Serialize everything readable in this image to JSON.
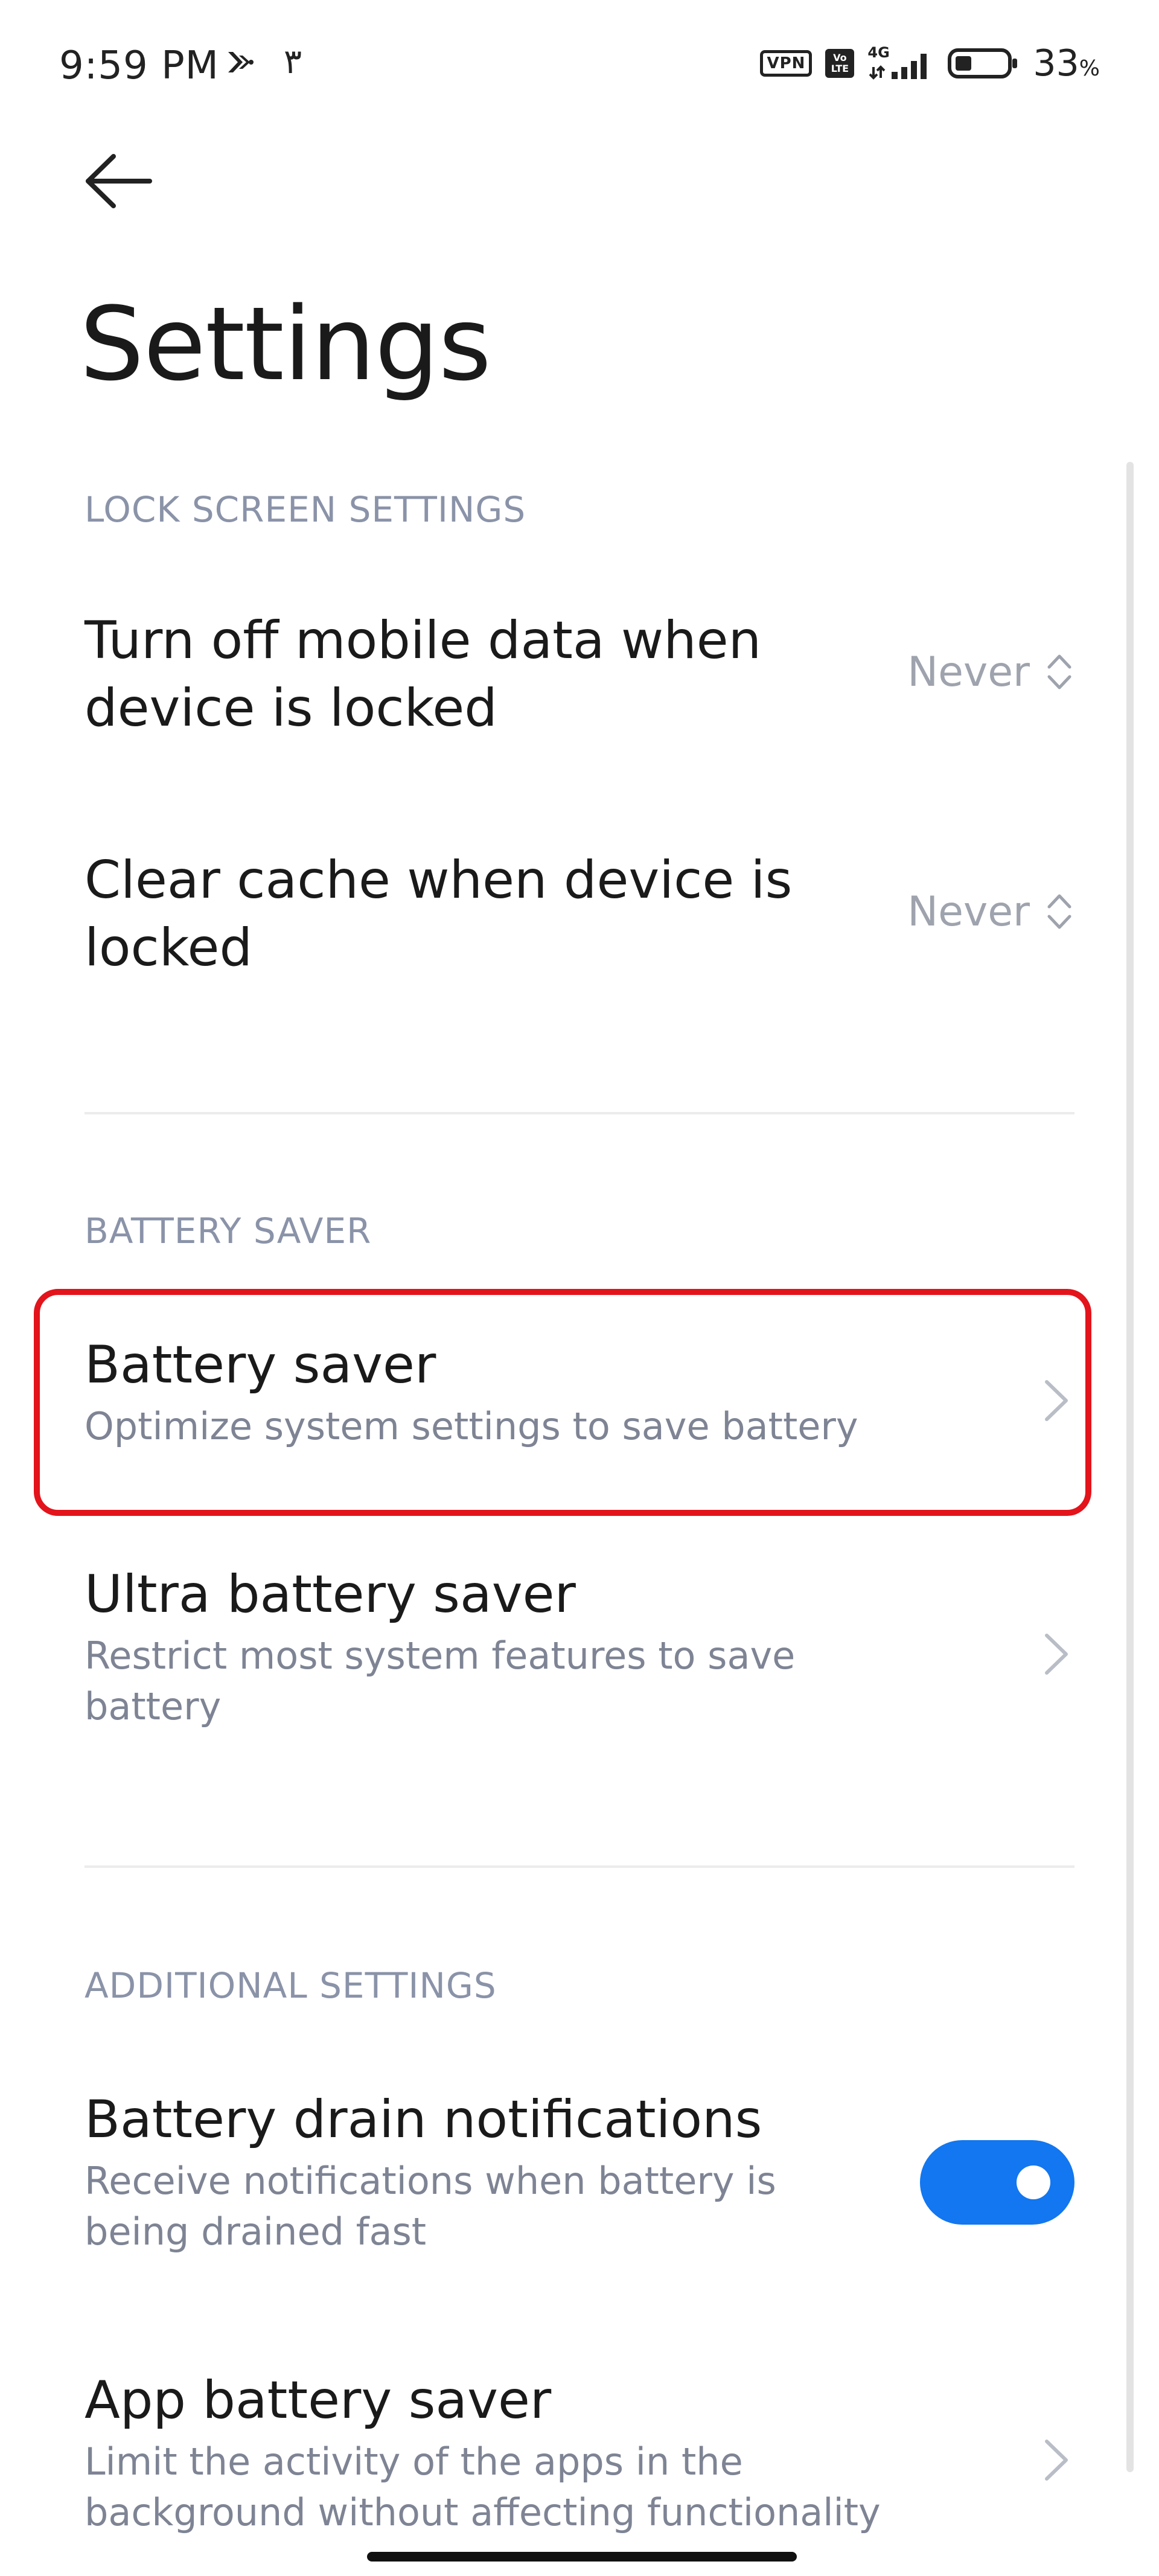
{
  "status_bar": {
    "time": "9:59 PM",
    "extra_digit": "٣",
    "vpn_label": "VPN",
    "volte_top": "Vo",
    "volte_bottom": "LTE",
    "network_label": "4G",
    "battery_percent": "33",
    "battery_unit": "%",
    "battery_level": 0.33,
    "left_icon": "app-notification-icon"
  },
  "header": {
    "back_icon": "back-arrow-icon",
    "title": "Settings"
  },
  "sections": {
    "lock_screen": {
      "header": "LOCK SCREEN SETTINGS",
      "items": [
        {
          "title_line1": "Turn off mobile data when",
          "title_line2": "device is locked",
          "value": "Never"
        },
        {
          "title_line1": "Clear cache when device is",
          "title_line2": "locked",
          "value": "Never"
        }
      ]
    },
    "battery_saver": {
      "header": "BATTERY SAVER",
      "items": [
        {
          "title": "Battery saver",
          "subtitle": "Optimize system settings to save battery"
        },
        {
          "title": "Ultra battery saver",
          "subtitle_line1": "Restrict most system features to save",
          "subtitle_line2": "battery"
        }
      ]
    },
    "additional": {
      "header": "ADDITIONAL SETTINGS",
      "items": [
        {
          "title": "Battery drain notifications",
          "subtitle_line1": "Receive notifications when battery is",
          "subtitle_line2": "being drained fast",
          "toggle_on": true
        },
        {
          "title": "App battery saver",
          "subtitle_line1": "Limit the activity of the apps in the",
          "subtitle_line2": "background without affecting functionality"
        }
      ]
    }
  },
  "colors": {
    "accent": "#1277f0",
    "highlight": "#e3141b",
    "section_header": "#8a93a8",
    "secondary_text": "#7e8494"
  }
}
